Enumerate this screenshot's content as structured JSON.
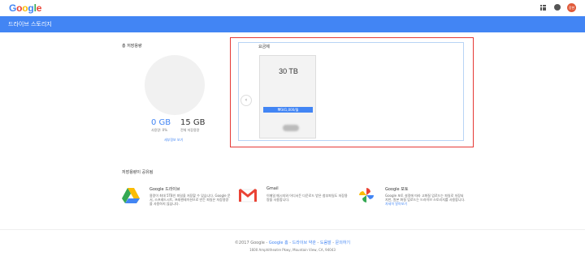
{
  "topbar": {
    "logo": [
      "G",
      "o",
      "o",
      "g",
      "l",
      "e"
    ],
    "avatar_text": "장현"
  },
  "header": {
    "title": "드라이브 스토리지"
  },
  "storage": {
    "total_label": "총 저장용량",
    "used_value": "0 GB",
    "used_label": "사용량: 0%",
    "total_value": "15 GB",
    "total_desc": "전체 저장용량",
    "details_link": "세부정보 보기"
  },
  "plans": {
    "heading": "요금제",
    "prev_label": "‹",
    "card": {
      "size": "30 TB",
      "price": "₩341,000/월"
    }
  },
  "shared": {
    "heading": "저장용량이 공유됨",
    "services": [
      {
        "title": "Google 드라이브",
        "desc": "용량이 최대 5TB인 파일을 저장할 수 있습니다. Google 문서, 스프레드시트, 프레젠테이션으로 만든 파일은 저장용량을 사용하지 않습니다.",
        "link": ""
      },
      {
        "title": "Gmail",
        "desc": "이메일 메시지와 어디서든 다운로드 받은 첨부파일도 저장용량을 사용합니다.",
        "link": ""
      },
      {
        "title": "Google 포토",
        "desc": "Google 포토 설정에 따라 고화질 업로드는 파일로 저장되지만, 원본 화질 업로드는 드라이브 스토리지를 사용합니다.",
        "link": "자세히 알아보기"
      }
    ]
  },
  "footer": {
    "copyright": "©2017 Google",
    "links": [
      "Google 홈",
      "드라이브 약관",
      "도움말",
      "문의하기"
    ],
    "separator": " - ",
    "address": "1600 Amphitheatre Pkwy, Mountain View, CA, 94043"
  },
  "colors": {
    "brand_blue": "#4285f4",
    "highlight_red": "#e53935",
    "drive_yellow": "#fbbc05",
    "gmail_red": "#ea4335"
  }
}
